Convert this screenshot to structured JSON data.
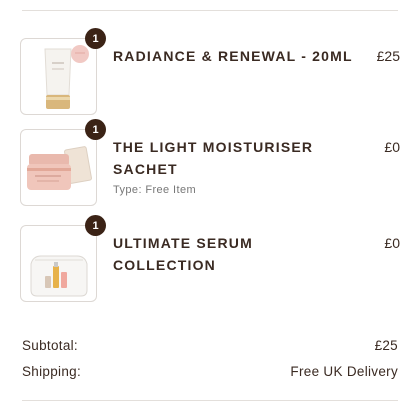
{
  "cart": {
    "items": [
      {
        "quantity": "1",
        "title": "RADIANCE & RENEWAL - 20ML",
        "price": "£25",
        "type": "",
        "image": "tube-cream-icon"
      },
      {
        "quantity": "1",
        "title": "THE LIGHT MOISTURISER SACHET",
        "price": "£0",
        "type": "Type: Free Item",
        "image": "moisturiser-jar-icon"
      },
      {
        "quantity": "1",
        "title": "ULTIMATE SERUM COLLECTION",
        "price": "£0",
        "type": "",
        "image": "cosmetic-bag-icon"
      }
    ]
  },
  "summary": {
    "subtotal_label": "Subtotal:",
    "subtotal_value": "£25",
    "shipping_label": "Shipping:",
    "shipping_value": "Free UK Delivery"
  },
  "colors": {
    "badge": "#3b2316",
    "text": "#3a2a22",
    "border": "#ddd8d4"
  }
}
